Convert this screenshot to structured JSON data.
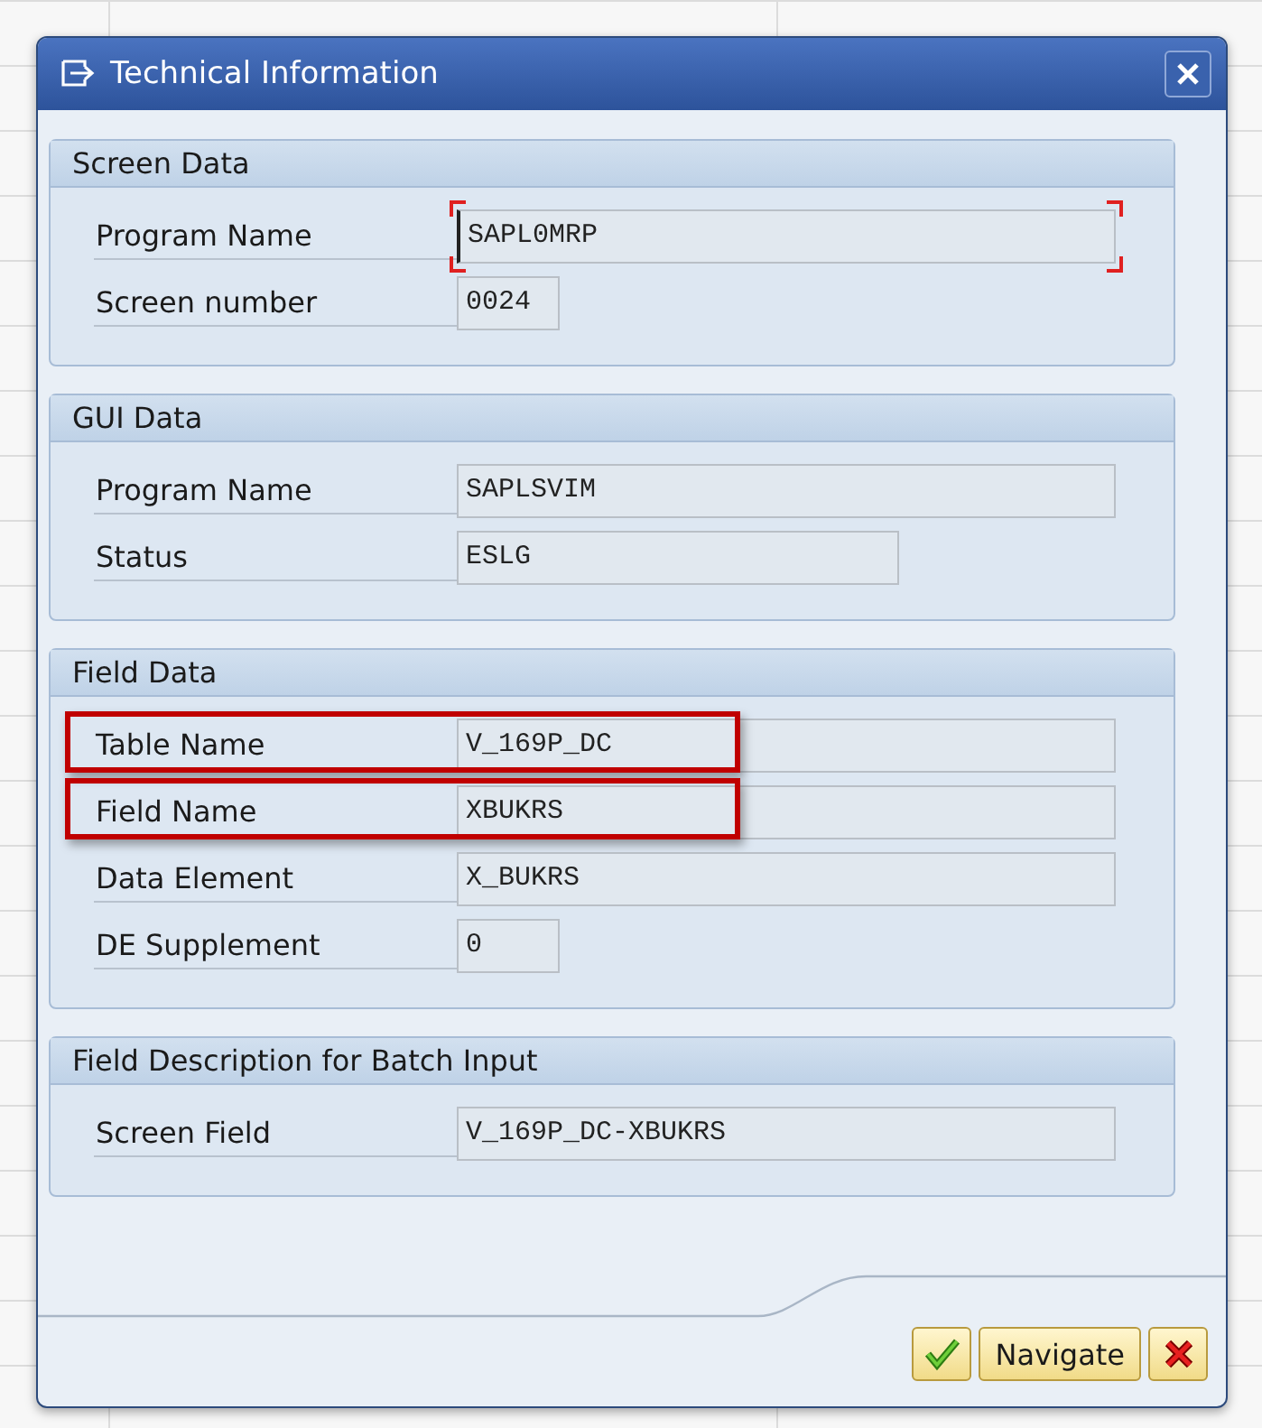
{
  "window": {
    "title": "Technical Information"
  },
  "groups": [
    {
      "title": "Screen Data",
      "rows": [
        {
          "label": "Program Name",
          "value": "SAPL0MRP",
          "kind": "long",
          "focused": true,
          "highlighted": false
        },
        {
          "label": "Screen number",
          "value": "0024",
          "kind": "short",
          "focused": false,
          "highlighted": false
        }
      ]
    },
    {
      "title": "GUI Data",
      "rows": [
        {
          "label": "Program Name",
          "value": "SAPLSVIM",
          "kind": "long",
          "focused": false,
          "highlighted": false
        },
        {
          "label": "Status",
          "value": "ESLG",
          "kind": "medium",
          "focused": false,
          "highlighted": false
        }
      ]
    },
    {
      "title": "Field Data",
      "rows": [
        {
          "label": "Table Name",
          "value": "V_169P_DC",
          "kind": "long",
          "focused": false,
          "highlighted": true
        },
        {
          "label": "Field Name",
          "value": "XBUKRS",
          "kind": "long",
          "focused": false,
          "highlighted": true
        },
        {
          "label": "Data Element",
          "value": "X_BUKRS",
          "kind": "long",
          "focused": false,
          "highlighted": false
        },
        {
          "label": "DE Supplement",
          "value": "0",
          "kind": "short",
          "focused": false,
          "highlighted": false
        }
      ]
    },
    {
      "title": "Field Description for Batch Input",
      "rows": [
        {
          "label": "Screen Field",
          "value": "V_169P_DC-XBUKRS",
          "kind": "long",
          "focused": false,
          "highlighted": false
        }
      ]
    }
  ],
  "buttons": [
    {
      "kind": "confirm"
    },
    {
      "kind": "text",
      "label": "Navigate"
    },
    {
      "kind": "cancel"
    }
  ]
}
